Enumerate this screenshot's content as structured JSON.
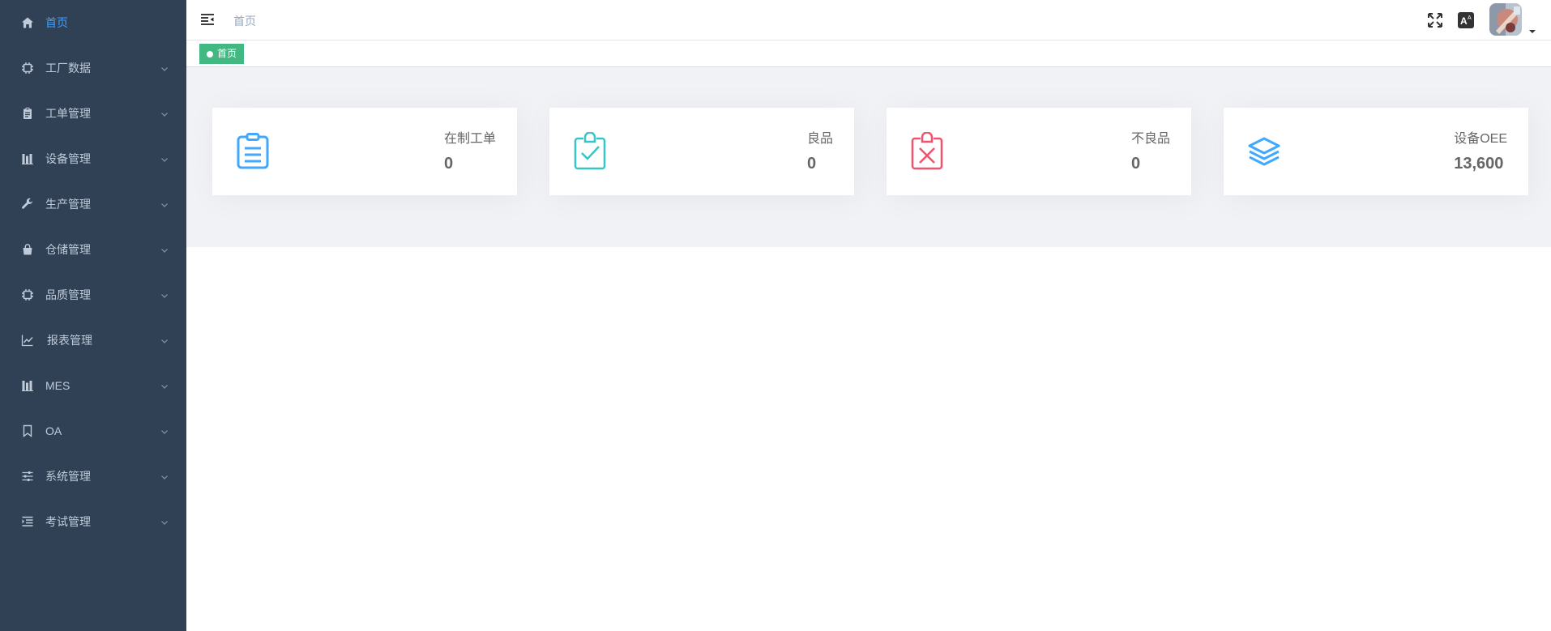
{
  "sidebar": {
    "items": [
      {
        "label": "首页",
        "icon": "home-icon",
        "active": true,
        "has_children": false
      },
      {
        "label": "工厂数据",
        "icon": "chip-icon",
        "has_children": true
      },
      {
        "label": "工单管理",
        "icon": "clipboard-icon",
        "has_children": true
      },
      {
        "label": "设备管理",
        "icon": "chart-bars-icon",
        "has_children": true
      },
      {
        "label": "生产管理",
        "icon": "wrench-icon",
        "has_children": true
      },
      {
        "label": "仓储管理",
        "icon": "shopping-bag-icon",
        "has_children": true
      },
      {
        "label": "品质管理",
        "icon": "chip-icon",
        "has_children": true
      },
      {
        "label": "报表管理",
        "icon": "line-chart-icon",
        "has_children": true
      },
      {
        "label": "MES",
        "icon": "chart-bars-icon",
        "has_children": true
      },
      {
        "label": "OA",
        "icon": "bookmark-icon",
        "has_children": true
      },
      {
        "label": "系统管理",
        "icon": "sliders-icon",
        "has_children": true
      },
      {
        "label": "考试管理",
        "icon": "list-indent-icon",
        "has_children": true
      }
    ],
    "colors": {
      "background": "#304156",
      "text": "#bfcbd9",
      "active": "#409eff"
    }
  },
  "navbar": {
    "breadcrumb": "首页"
  },
  "tags_view": {
    "tags": [
      {
        "label": "首页",
        "active": true
      }
    ],
    "active_color": "#42b983"
  },
  "panel": {
    "cards": [
      {
        "label": "在制工单",
        "value": "0",
        "icon": "clipboard-list-icon",
        "color": "#40a9ff"
      },
      {
        "label": "良品",
        "value": "0",
        "icon": "clipboard-check-icon",
        "color": "#36c6c6"
      },
      {
        "label": "不良品",
        "value": "0",
        "icon": "clipboard-x-icon",
        "color": "#f4516c"
      },
      {
        "label": "设备OEE",
        "value": "13,600",
        "icon": "layers-icon",
        "color": "#34bfa3"
      }
    ]
  }
}
